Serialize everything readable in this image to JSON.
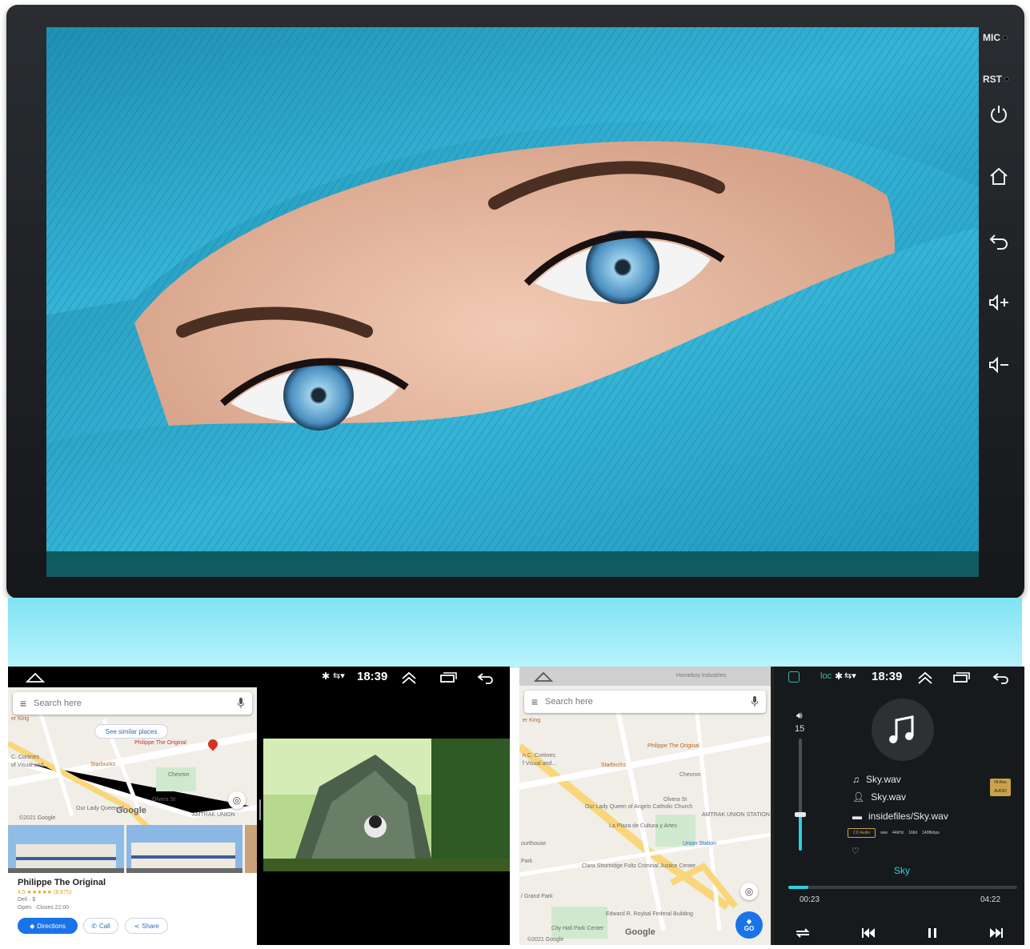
{
  "device": {
    "side_labels": {
      "mic": "MIC",
      "rst": "RST"
    },
    "buttons": [
      "power-icon",
      "home-icon",
      "back-icon",
      "volume-up-icon",
      "volume-down-icon"
    ],
    "photo_subject": "",
    "colors": {
      "bezel": "#1c1e21",
      "fabric": "#2aa7c9",
      "band": "#9cecf8"
    }
  },
  "status_bar": {
    "time_left": "18:39",
    "time_right": "18:39",
    "icons": [
      "home-icon",
      "bluetooth-icon",
      "wifi-icon",
      "chevron-up-icon",
      "recent-apps-icon",
      "back-icon"
    ]
  },
  "map_left": {
    "search_placeholder": "Search here",
    "similar_places": "See similar places",
    "labels": {
      "philippe": "Philippe The Original",
      "starbucks": "Starbucks",
      "chevron": "Chevron",
      "olvera": "Olvera St",
      "cortines": "C. Cortines",
      "visual": "of Visual and...",
      "amtrak": "AMTRAK UNION",
      "our_lady": "Our Lady Queen of",
      "king": "er King",
      "copyright": "©2021 Google",
      "google": "Google"
    },
    "place": {
      "title": "Philippe The Original",
      "rating": "4.5 ★★★★★ (8,675)",
      "category": "Deli · $",
      "hours": "Open · Closes 22:00"
    },
    "actions": {
      "directions": "Directions",
      "call": "Call",
      "share": "Share"
    }
  },
  "map_right": {
    "top_text": "Homeboy Industries",
    "search_placeholder": "Search here",
    "labels": {
      "king": "er King",
      "philippe": "Philippe The Original",
      "starbucks": "Starbucks",
      "chevron": "Chevron",
      "olvera": "Olvera St",
      "cortines": "n C. Cortines",
      "visual": "f Visual and...",
      "our_lady": "Our Lady Queen of Angels Catholic Church",
      "plaza": "La Plaza de Cultura y Artes",
      "amtrak": "AMTRAK UNION STATION",
      "union": "Union Station",
      "courthouse": "ourthouse",
      "park": "Park",
      "clara": "Clara Shortridge Foltz Criminal Justice Center",
      "grand_park": "/ Grand Park",
      "roybal": "Edward R. Roybal Federal Building",
      "city_hall": "City Hall Park Center",
      "copyright": "©2021 Google",
      "google": "Google",
      "go": "GO"
    }
  },
  "music": {
    "status_text": "loc",
    "volume": "15",
    "volume_level": 0.32,
    "track": "Sky.wav",
    "artist": "Sky.wav",
    "path": "insidefiles/Sky.wav",
    "formats": [
      "CD Audio",
      "wav",
      "44kHz",
      "16bit",
      "1408kbps"
    ],
    "hires": "Hi-Res AUDIO",
    "title": "Sky",
    "elapsed": "00:23",
    "duration": "04:22",
    "progress": 0.088
  }
}
